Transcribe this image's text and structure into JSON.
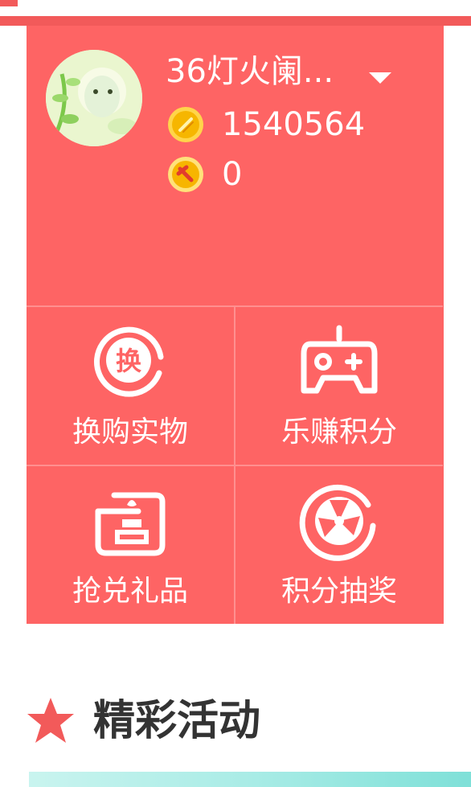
{
  "profile": {
    "username": "36灯火阑...",
    "coins": "1540564",
    "points": "0"
  },
  "menu": [
    {
      "label": "换购实物",
      "icon": "exchange-icon"
    },
    {
      "label": "乐赚积分",
      "icon": "gamepad-icon"
    },
    {
      "label": "抢兑礼品",
      "icon": "gift-icon"
    },
    {
      "label": "积分抽奖",
      "icon": "lottery-wheel-icon"
    }
  ],
  "exchange_glyph": "换",
  "section": {
    "title": "精彩活动"
  },
  "colors": {
    "accent": "#fe6464",
    "star": "#f25a5a",
    "title": "#333333"
  }
}
